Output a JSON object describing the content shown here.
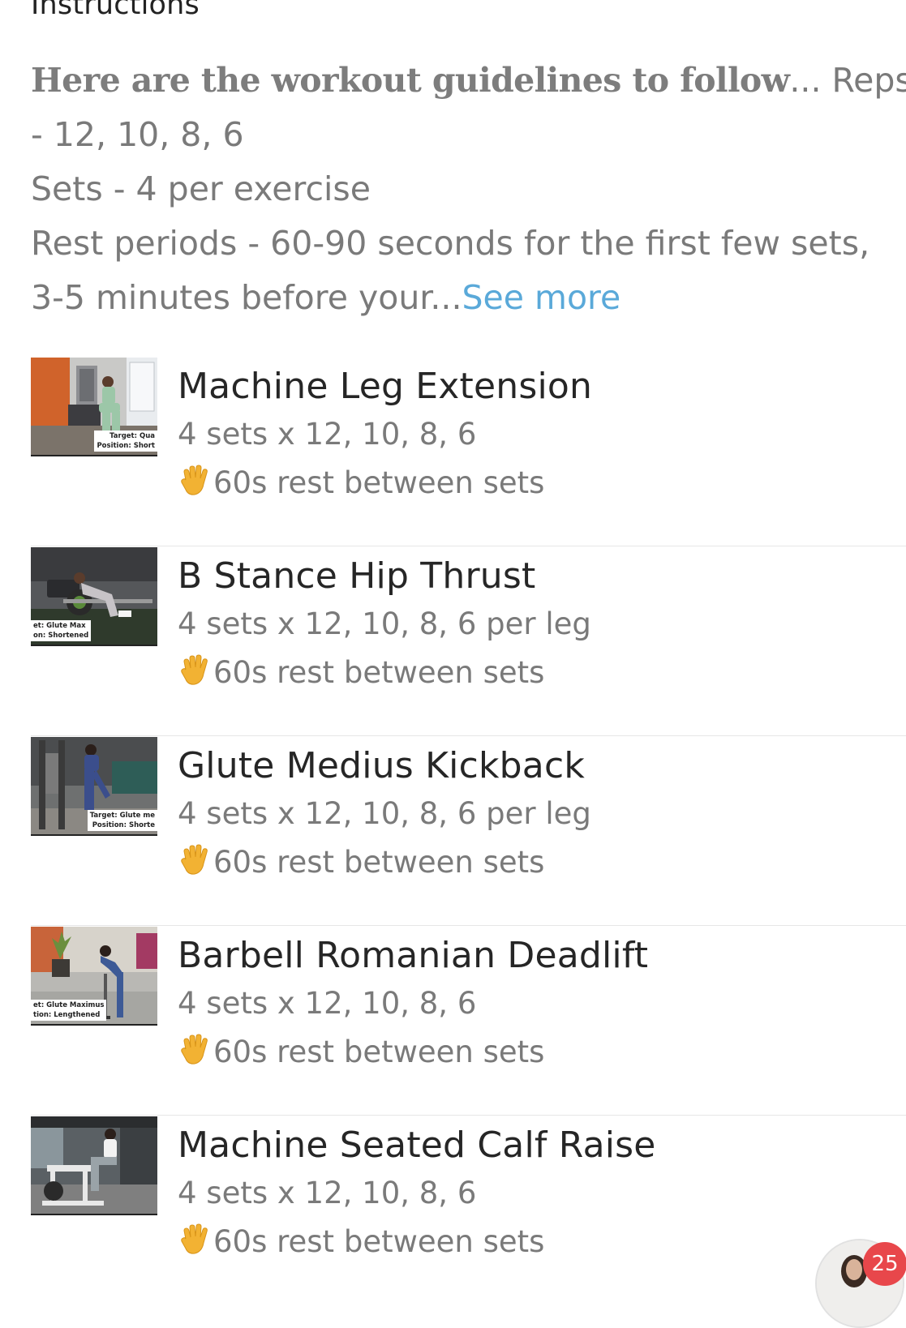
{
  "section": {
    "title": "Instructions"
  },
  "instructions": {
    "bold_intro": "Here are the workout guidelines to follow",
    "ellipsis": "...",
    "line1_tail": " Reps",
    "line2": "- 12, 10, 8, 6",
    "line3": "Sets - 4 per exercise",
    "line4": "Rest periods - 60-90 seconds for the first few sets,",
    "line5": "3-5 minutes before your...",
    "see_more": "See more"
  },
  "exercises": [
    {
      "name": "Machine Leg Extension",
      "sets": "4 sets x 12, 10, 8, 6",
      "rest": "60s rest between sets",
      "thumb_caption_1": "Target: Qua",
      "thumb_caption_2": "Position: Short"
    },
    {
      "name": "B Stance Hip Thrust",
      "sets": "4 sets x 12, 10, 8, 6 per leg",
      "rest": "60s rest between sets",
      "thumb_caption_1": "et: Glute Max",
      "thumb_caption_2": "on: Shortened"
    },
    {
      "name": "Glute Medius Kickback",
      "sets": "4 sets x 12, 10, 8, 6 per leg",
      "rest": "60s rest between sets",
      "thumb_caption_1": "Target: Glute me",
      "thumb_caption_2": "Position: Shorte"
    },
    {
      "name": "Barbell Romanian Deadlift",
      "sets": "4 sets x 12, 10, 8, 6",
      "rest": "60s rest between sets",
      "thumb_caption_1": "et: Glute Maximus",
      "thumb_caption_2": "tion: Lengthened"
    },
    {
      "name": "Machine Seated Calf Raise",
      "sets": "4 sets x 12, 10, 8, 6",
      "rest": "60s rest between sets"
    }
  ],
  "icons": {
    "rest": "raised-hand-icon",
    "chat": "coach-avatar-icon"
  },
  "chat": {
    "badge_count": "25"
  },
  "colors": {
    "link": "#5aa9d9",
    "badge": "#e8474b",
    "hand": "#f2b233",
    "muted_text": "#7a7a7a",
    "title_text": "#262626"
  }
}
